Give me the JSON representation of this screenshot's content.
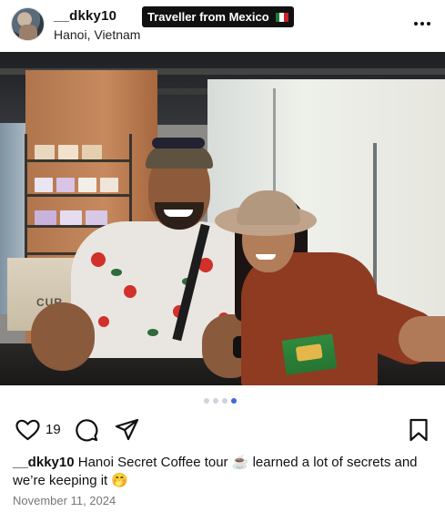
{
  "post": {
    "username": "__dkky10",
    "location": "Hanoi, Vietnam",
    "badge": "Traveller from Mexico",
    "badge_flag": "flag-mexico",
    "likes": "19",
    "caption_username": "__dkky10",
    "caption_text": "Hanoi Secret Coffee tour ☕ learned a lot of secrets and we’re keeping it 🤭",
    "date": "November 11, 2024"
  },
  "carousel": {
    "total": 4,
    "active_index": 4
  },
  "icons": {
    "more": "more-horizontal-icon",
    "like": "heart-icon",
    "comment": "comment-bubble-icon",
    "share": "paper-plane-icon",
    "save": "bookmark-icon"
  },
  "colors": {
    "active_dot": "#3f66d9",
    "inactive_dot": "#cfd3da",
    "badge_bg": "#111111",
    "date": "#777777"
  }
}
